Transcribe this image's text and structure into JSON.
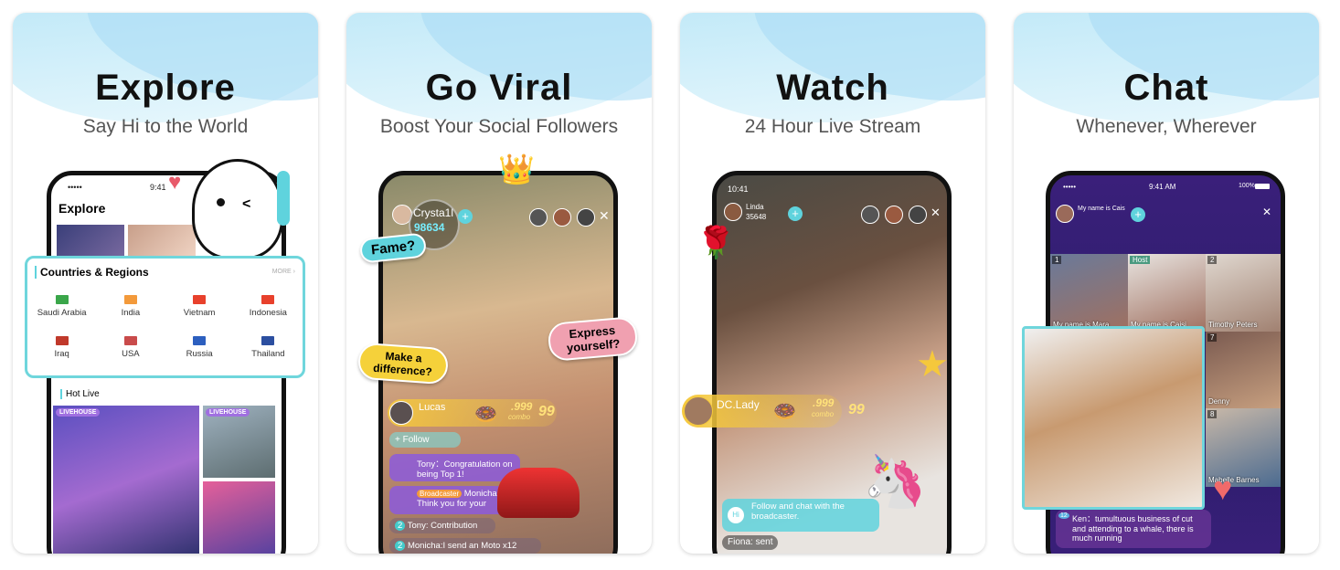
{
  "cards": [
    {
      "title": "Explore",
      "subtitle": "Say Hi to the World",
      "phone": {
        "status_dots": "•••••",
        "time": "9:41",
        "header": "Explore",
        "countries": {
          "title": "Countries & Regions",
          "more": "MORE ›",
          "items": [
            {
              "name": "Saudi Arabia",
              "color": "#3aa64a"
            },
            {
              "name": "India",
              "color": "#f39a3b"
            },
            {
              "name": "Vietnam",
              "color": "#e8412c"
            },
            {
              "name": "Indonesia",
              "color": "#e8412c"
            },
            {
              "name": "Iraq",
              "color": "#c0392b"
            },
            {
              "name": "USA",
              "color": "#c94b4b"
            },
            {
              "name": "Russia",
              "color": "#2c5fbf"
            },
            {
              "name": "Thailand",
              "color": "#2c4fa0"
            }
          ]
        },
        "hot_live": "Hot Live",
        "badge": "LIVEHOUSE"
      }
    },
    {
      "title": "Go Viral",
      "subtitle": "Boost Your Social Followers",
      "phone": {
        "host_name": "Crysta1l",
        "host_fans": "98634",
        "bubbles": [
          "Fame?",
          "Express yourself?",
          "Make a difference?"
        ],
        "gift": {
          "user": "Lucas",
          "count": ".999",
          "combo": "combo",
          "multiplier": "99"
        },
        "follow": "+ Follow",
        "messages": [
          {
            "text": "Tony：Congratulation on being Top 1!"
          },
          {
            "badge": "Broadcaster",
            "name": "Monicha",
            "text": "Think you for your"
          },
          {
            "level": "2",
            "text": "Tony: Contribution"
          },
          {
            "level": "2",
            "text": "Monicha:I send an Moto  x12"
          }
        ]
      }
    },
    {
      "title": "Watch",
      "subtitle": "24 Hour Live Stream",
      "phone": {
        "time": "10:41",
        "host_name": "Linda",
        "host_fans": "35648",
        "gift": {
          "user": "DC.Lady",
          "count": ".999",
          "combo": "combo",
          "multiplier": "99"
        },
        "hint_icon": "Hi",
        "hint": "Follow and chat with the broadcaster.",
        "last_msg": "Fiona: sent"
      }
    },
    {
      "title": "Chat",
      "subtitle": "Whenever, Wherever",
      "phone": {
        "status_dots": "•••••",
        "time": "9:41 AM",
        "battery": "100%",
        "room_name": "My name is Cais",
        "seats": [
          {
            "num": "1",
            "name": "My name is Mara"
          },
          {
            "num": "Host",
            "name": "My name is Caisi"
          },
          {
            "num": "2",
            "name": "Timothy Peters"
          },
          {
            "num": "7",
            "name": "Denny"
          },
          {
            "num": "8",
            "name": "Mabelle Barnes"
          }
        ],
        "message": {
          "level": "12",
          "text": "Ken：tumultuous business of cut and attending to a whale, there is much running"
        }
      }
    }
  ],
  "colors": {
    "accent": "#5fd3dd",
    "yellow": "#f5d13a",
    "pink": "#f0a0b0",
    "purple": "#3a1f7a"
  }
}
